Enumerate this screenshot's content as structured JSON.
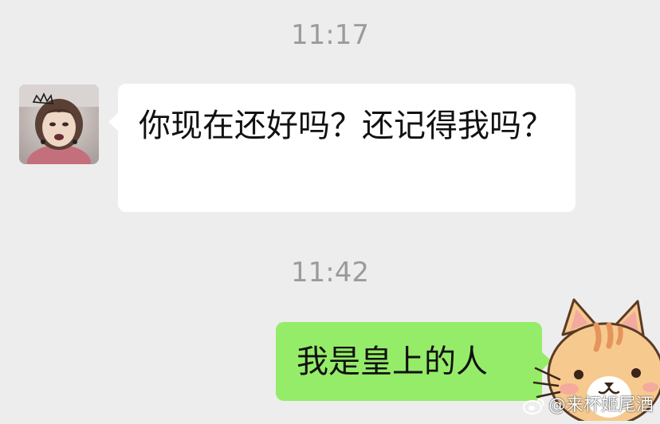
{
  "chat": {
    "messages": [
      {
        "timestamp": "11:17",
        "sender": "contact",
        "text": "你现在还好吗？还记得我吗？",
        "avatar_icon": "girl-photo-avatar"
      },
      {
        "timestamp": "11:42",
        "sender": "self",
        "text": "我是皇上的人"
      }
    ]
  },
  "sticker": {
    "icon": "orange-cat-sticker"
  },
  "watermark": {
    "text": "@来杯姬尾酒",
    "icon": "weibo-logo-icon"
  },
  "colors": {
    "background": "#ededed",
    "incoming_bubble": "#ffffff",
    "outgoing_bubble": "#95ec69",
    "timestamp_text": "#9b9b9b",
    "message_text": "#111111"
  }
}
